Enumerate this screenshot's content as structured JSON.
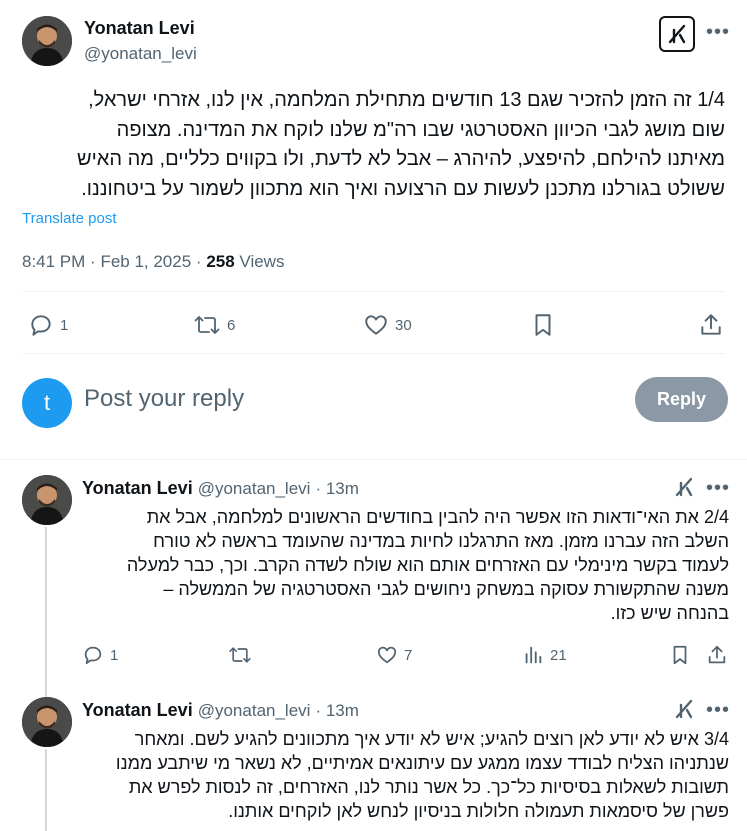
{
  "main_tweet": {
    "name": "Yonatan Levi",
    "handle": "@yonatan_levi",
    "text_lines": [
      "1/4 זה הזמן להזכיר שגם 13 חודשים מתחילת המלחמה, אין לנו, אזרחי ישראל,",
      "שום מושג לגבי הכיוון האסטרטגי שבו רה\"מ שלנו לוקח את המדינה. מצופה",
      "מאיתנו להילחם, להיפצע, להיהרג – אבל לא לדעת, ולו בקווים כלליים, מה האיש",
      "ששולט בגורלנו מתכנן לעשות עם הרצועה ואיך הוא מתכוון לשמור על ביטחוננו."
    ],
    "translate_label": "Translate post",
    "time": "8:41 PM",
    "date": "Feb 1, 2025",
    "views_count": "258",
    "views_label": "Views",
    "replies": "1",
    "reposts": "6",
    "likes": "30"
  },
  "reply_box": {
    "avatar_letter": "t",
    "placeholder": "Post your reply",
    "button_label": "Reply",
    "avatar_color": "#1d9bf0",
    "button_color": "#8b98a5"
  },
  "replies": [
    {
      "name": "Yonatan Levi",
      "handle": "@yonatan_levi",
      "time": "13m",
      "text_lines": [
        "2/4 את האי־ודאות הזו אפשר היה להבין בחודשים הראשונים למלחמה, אבל את",
        "השלב הזה עברנו מזמן. מאז התרגלנו לחיות במדינה שהעומד בראשה לא טורח",
        "לעמוד בקשר מינימלי עם האזרחים אותם הוא שולח לשדה הקרב. וכך, כבר למעלה",
        "משנה שהתקשורת עסוקה במשחק ניחושים לגבי האסטרטגיה של הממשלה –",
        "בהנחה שיש כזו."
      ],
      "replies": "1",
      "likes": "7",
      "views": "21"
    },
    {
      "name": "Yonatan Levi",
      "handle": "@yonatan_levi",
      "time": "13m",
      "text_lines": [
        "3/4 איש לא יודע לאן רוצים להגיע; איש לא יודע איך מתכוונים להגיע לשם. ומאחר",
        "שנתניהו הצליח לבודד עצמו ממגע עם עיתונאים אמיתיים, לא נשאר מי שיתבע ממנו",
        "תשובות לשאלות בסיסיות כל־כך. כל אשר נותר לנו, האזרחים, זה לנסות לפרש את",
        "פשרן של סיסמאות תעמולה חלולות בניסיון לנחש לאן לוקחים אותנו."
      ]
    }
  ],
  "colors": {
    "text": "#0f1419",
    "secondary": "#536471",
    "link": "#1d9bf0",
    "thread_line": "#cfd9de"
  }
}
